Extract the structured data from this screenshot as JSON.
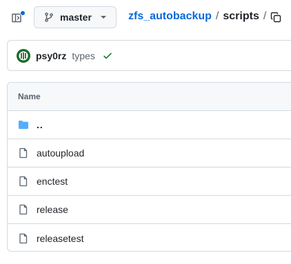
{
  "header": {
    "branch": "master",
    "breadcrumb": {
      "repo": "zfs_autobackup",
      "separator": "/",
      "current": "scripts",
      "trailing_separator": "/"
    }
  },
  "commit": {
    "author": "psy0rz",
    "message": "types"
  },
  "file_table": {
    "header_name": "Name",
    "rows": [
      {
        "name": "..",
        "icon": "folder-icon"
      },
      {
        "name": "autoupload",
        "icon": "file-icon"
      },
      {
        "name": "enctest",
        "icon": "file-icon"
      },
      {
        "name": "release",
        "icon": "file-icon"
      },
      {
        "name": "releasetest",
        "icon": "file-icon"
      }
    ]
  },
  "colors": {
    "accent": "#0969da",
    "success": "#1a7f37",
    "border": "#d1d9e0",
    "muted_text": "#59636e",
    "folder": "#54aeff"
  }
}
